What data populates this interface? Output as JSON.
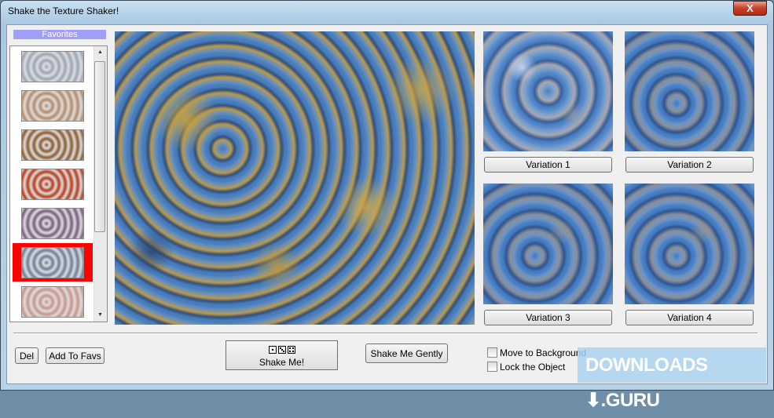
{
  "window": {
    "title": "Shake the Texture Shaker!",
    "close_label": "X"
  },
  "favorites": {
    "label": "Favorites",
    "items": [
      {
        "color": "#9aa4b8"
      },
      {
        "color": "#b48a6a"
      },
      {
        "color": "#8a5a30"
      },
      {
        "color": "#b83a1a"
      },
      {
        "color": "#7a5a80"
      },
      {
        "color": "#6a7f9a",
        "selected": true
      },
      {
        "color": "#c8948a"
      }
    ]
  },
  "variations": [
    {
      "label": "Variation 1"
    },
    {
      "label": "Variation 2"
    },
    {
      "label": "Variation 3"
    },
    {
      "label": "Variation 4"
    }
  ],
  "buttons": {
    "del": "Del",
    "add_to_favs": "Add To Favs",
    "shake_me": "Shake Me!",
    "shake_gently": "Shake Me Gently"
  },
  "checkboxes": {
    "move_to_background": "Move to Background",
    "lock_object": "Lock the Object"
  },
  "watermark": "DOWNLOADS ⬇.GURU"
}
